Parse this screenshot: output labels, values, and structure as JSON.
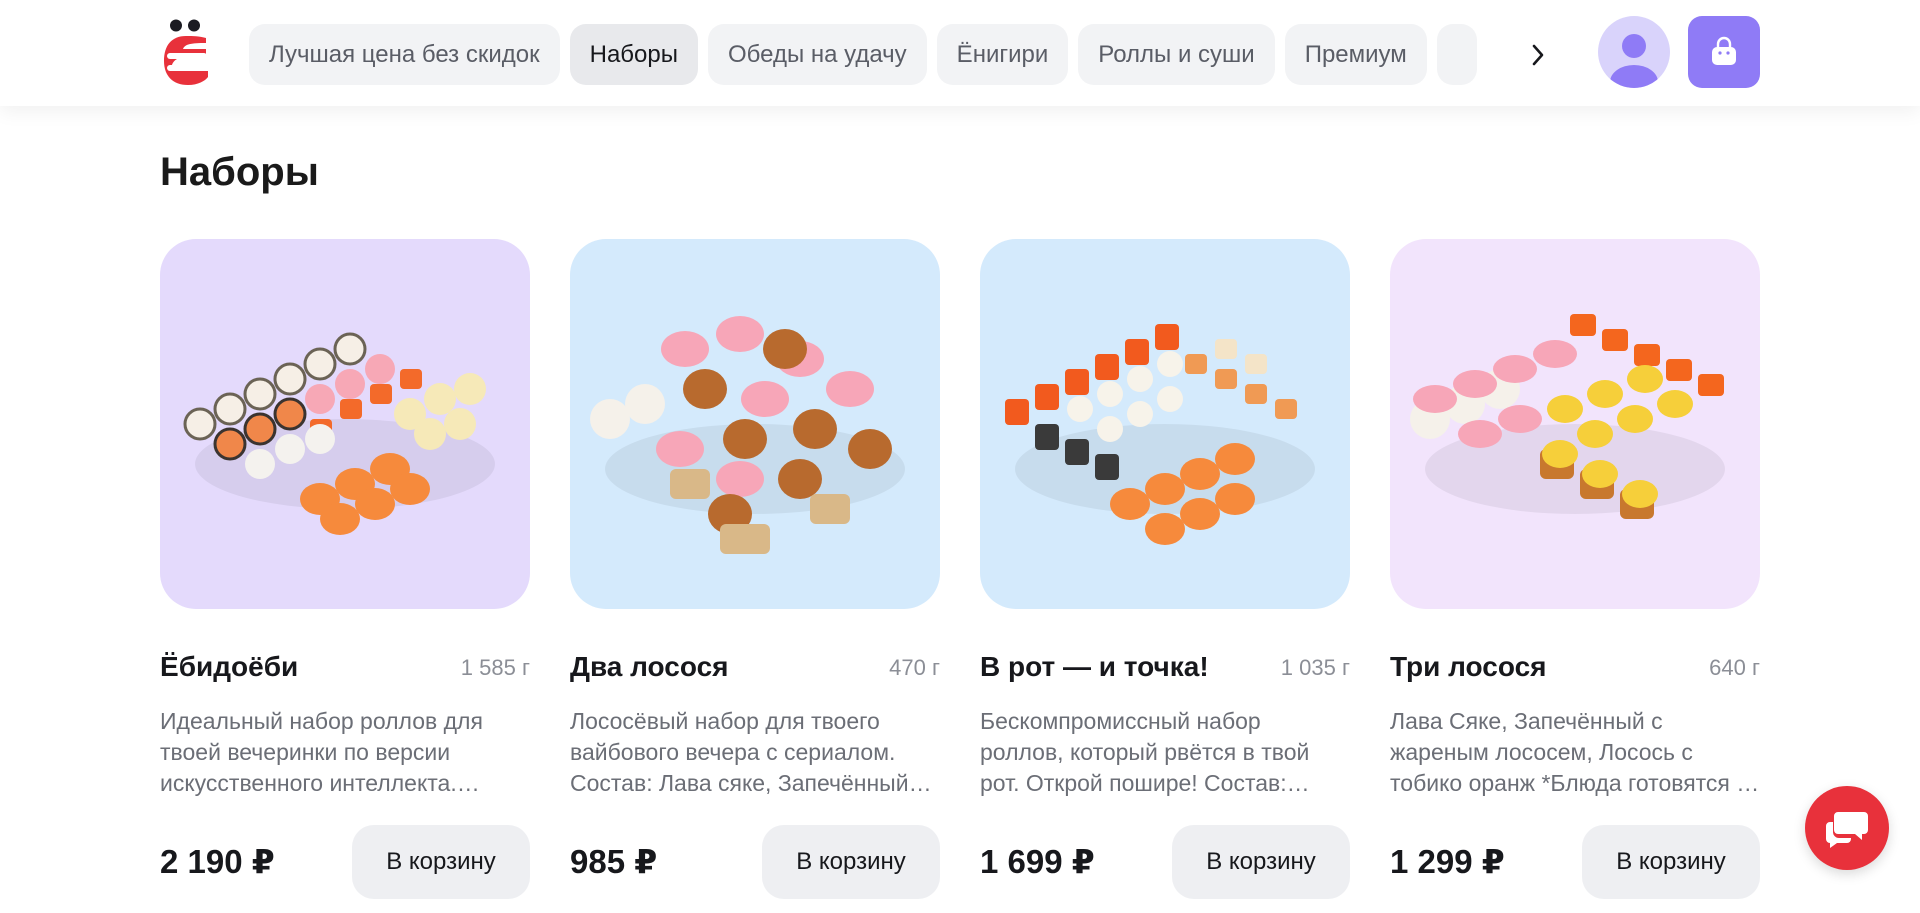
{
  "header": {
    "logo_icon": "eda-logo-icon",
    "nav_tabs": [
      {
        "label": "Лучшая цена без скидок",
        "active": false
      },
      {
        "label": "Наборы",
        "active": true
      },
      {
        "label": "Обеды на удачу",
        "active": false
      },
      {
        "label": "Ёнигири",
        "active": false
      },
      {
        "label": "Роллы и суши",
        "active": false
      },
      {
        "label": "Премиум",
        "active": false
      },
      {
        "label": "",
        "active": false
      }
    ],
    "next_icon": "chevron-right-icon",
    "profile_icon": "user-avatar-icon",
    "cart_icon": "shopping-bag-icon"
  },
  "page": {
    "title": "Наборы"
  },
  "products": [
    {
      "name": "Ёбидоёби",
      "weight": "1 585 г",
      "description": "Идеальный набор роллов для твоей вечеринки по версии искусственного интеллекта. Состав: роллы",
      "price": "2 190 ₽",
      "button": "В корзину",
      "image_bg": "#e4dafc"
    },
    {
      "name": "Два лосося",
      "weight": "470 г",
      "description": "Лососёвый набор для твоего вайбового вечера с сериалом. Состав: Лава сяке, Запечённый лосось",
      "price": "985 ₽",
      "button": "В корзину",
      "image_bg": "#d4eafc"
    },
    {
      "name": "В рот — и точка!",
      "weight": "1 035 г",
      "description": "Бескомпромиссный набор роллов, который рвётся в твой рот. Открой пошире! Состав: роллы",
      "price": "1 699 ₽",
      "button": "В корзину",
      "image_bg": "#d4eafc"
    },
    {
      "name": "Три лосося",
      "weight": "640 г",
      "description": "Лава Сяке, Запечённый с жареным лососем, Лосось с тобико оранж *Блюда готовятся из охлаждённой рыбы",
      "price": "1 299 ₽",
      "button": "В корзину",
      "image_bg": "#f2e4fc"
    }
  ],
  "chat": {
    "icon": "chat-bubbles-icon"
  },
  "colors": {
    "brand_red": "#e8313b",
    "accent_purple": "#8f7bf6",
    "tab_bg": "#f2f3f5"
  }
}
